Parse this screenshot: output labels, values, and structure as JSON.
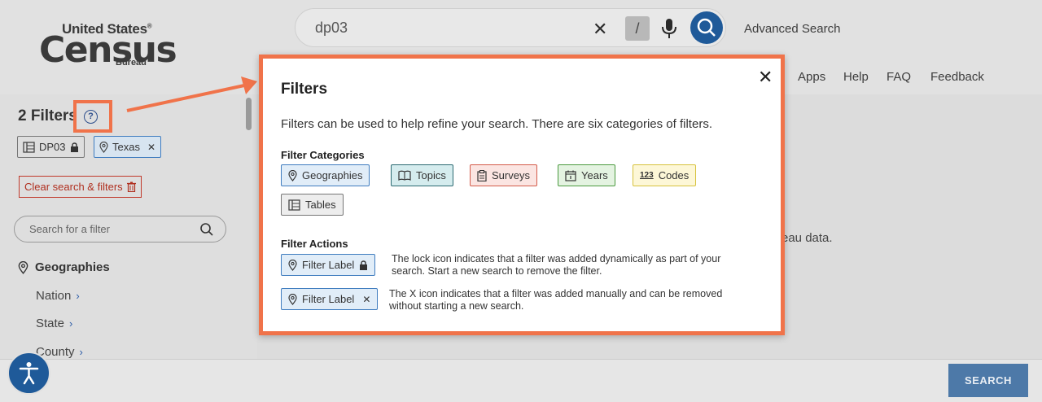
{
  "header": {
    "logo": {
      "line1": "United States",
      "line1_mark": "®",
      "line2": "Census",
      "line3": "Bureau"
    },
    "search": {
      "query": "dp03",
      "clear_glyph": "✕",
      "slash_key": "/"
    },
    "advanced_search": "Advanced Search",
    "nav": [
      "Apps",
      "Help",
      "FAQ",
      "Feedback"
    ]
  },
  "sidebar": {
    "title": "2 Filters",
    "help_glyph": "?",
    "chips": [
      {
        "label": "DP03",
        "icon": "table-icon",
        "trailing": "lock-icon"
      },
      {
        "label": "Texas",
        "icon": "pin-icon",
        "trailing": "✕"
      }
    ],
    "clear_label": "Clear search & filters",
    "filter_search_placeholder": "Search for a filter",
    "geographies": {
      "heading": "Geographies",
      "items": [
        "Nation",
        "State",
        "County"
      ],
      "chevron": "›"
    }
  },
  "main": {
    "partial_text": "eau data."
  },
  "bottom": {
    "search_button": "SEARCH"
  },
  "modal": {
    "title": "Filters",
    "close_glyph": "✕",
    "description": "Filters can be used to help refine your search. There are six categories of filters.",
    "categories_heading": "Filter Categories",
    "categories": [
      {
        "label": "Geographies",
        "icon": "pin-icon"
      },
      {
        "label": "Topics",
        "icon": "book-icon"
      },
      {
        "label": "Surveys",
        "icon": "clipboard-icon"
      },
      {
        "label": "Years",
        "icon": "calendar-icon"
      },
      {
        "label": "Codes",
        "icon": "codes-icon",
        "icon_text": "123"
      },
      {
        "label": "Tables",
        "icon": "table-icon"
      }
    ],
    "actions_heading": "Filter Actions",
    "actions": [
      {
        "chip_label": "Filter Label",
        "trailing": "lock-icon",
        "line1": "The lock icon indicates that a filter was added dynamically as part of your",
        "line2": "search. Start a new search to remove the filter."
      },
      {
        "chip_label": "Filter Label",
        "trailing": "✕",
        "line1": "The X icon indicates that a filter was added manually and can be removed",
        "line2": "without starting a new search."
      }
    ]
  },
  "colors": {
    "highlight": "#f0734a",
    "primary_blue": "#1f5a99",
    "search_button": "#4d79a8"
  }
}
